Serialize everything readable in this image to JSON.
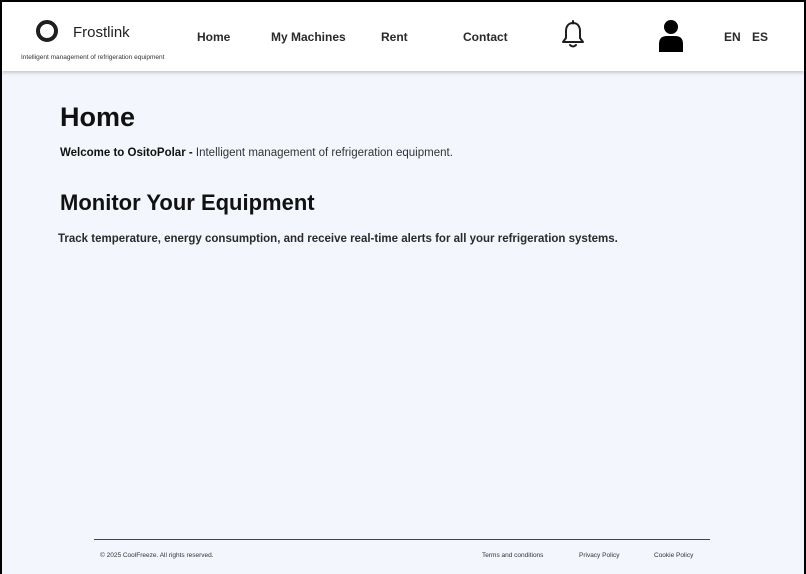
{
  "header": {
    "brand": "Frostlink",
    "tagline": "Intelligent management of refrigeration equipment",
    "nav": [
      "Home",
      "My Machines",
      "Rent",
      "Contact"
    ],
    "icons": [
      "logo-ring-icon",
      "bell-icon",
      "user-icon"
    ],
    "languages": [
      "EN",
      "ES"
    ]
  },
  "main": {
    "title": "Home",
    "welcome_strong": "Welcome to OsitoPolar -",
    "welcome_rest": " Intelligent management of refrigeration equipment.",
    "section_title": "Monitor Your Equipment",
    "section_desc": "Track temperature, energy consumption, and receive real-time alerts for all your refrigeration systems."
  },
  "footer": {
    "copyright": "© 2025 CoolFreeze. All rights reserved.",
    "links": [
      "Terms and conditions",
      "Privacy Policy",
      "Cookie Policy"
    ]
  }
}
